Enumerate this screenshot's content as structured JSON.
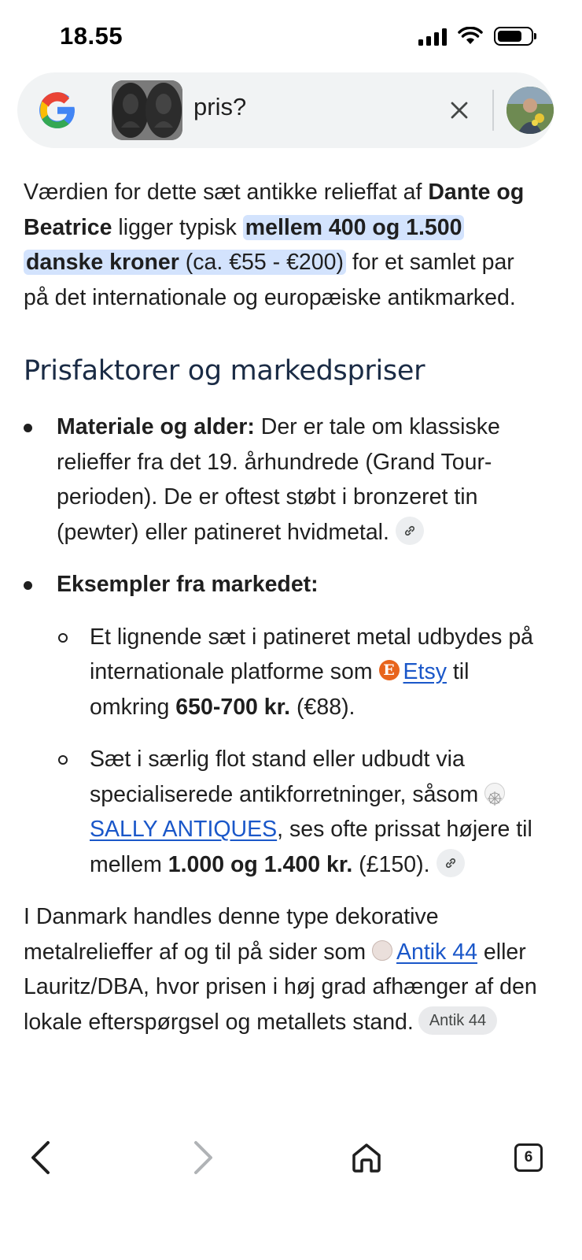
{
  "status_bar": {
    "time": "18.55"
  },
  "search": {
    "query": "pris?"
  },
  "answer": {
    "intro_parts": [
      "Værdien for dette sæt antikke relieffat af ",
      "Dante og Beatrice",
      " ligger typisk ",
      "mellem 400 og 1.500 danske kroner",
      " (ca. €55 - €200)",
      " for et samlet par på det internationale og europæiske antikmarked."
    ],
    "heading": "Prisfaktorer og markedspriser",
    "bullet1": {
      "label": "Materiale og alder:",
      "text": " Der er tale om klassiske relieffer fra det 19. århundrede (Grand Tour-perioden). De er oftest støbt i bronzeret tin (pewter) eller patineret hvidmetal."
    },
    "bullet2": {
      "label": "Eksempler fra markedet:"
    },
    "sub1": {
      "text1": "Et lignende sæt i patineret metal udbydes på internationale platforme som ",
      "etsy_icon": "E",
      "link": "Etsy",
      "text2": " til omkring ",
      "price": "650-700 kr.",
      "text3": " (€88)."
    },
    "sub2": {
      "text1": "Sæt i særlig flot stand eller udbudt via specialiserede antikforretninger, såsom ",
      "link": "SALLY ANTIQUES",
      "text2": ", ses ofte prissat højere til mellem ",
      "price": "1.000 og 1.400 kr.",
      "text3": " (£150)."
    },
    "dk": {
      "text1": "I Danmark handles denne type dekorative metalrelieffer af og til på sider som ",
      "link": "Antik 44",
      "text2": " eller Lauritz/DBA, hvor prisen i høj grad afhænger af den lokale efterspørgsel og metallets stand.",
      "chip": "Antik 44"
    }
  },
  "nav": {
    "tabs_count": "6"
  },
  "colors": {
    "highlight": "#d3e3fd",
    "link": "#1a57c9",
    "heading": "#1a2b45"
  }
}
